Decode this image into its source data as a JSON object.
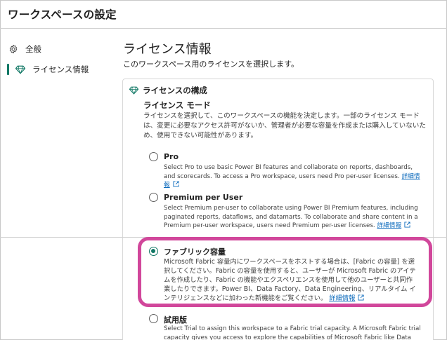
{
  "header": {
    "title": "ワークスペースの設定"
  },
  "sidebar": {
    "items": [
      {
        "label": "全般",
        "icon": "gear-icon"
      },
      {
        "label": "ライセンス情報",
        "icon": "diamond-icon"
      }
    ]
  },
  "main": {
    "title": "ライセンス情報",
    "subtitle": "このワークスペース用のライセンスを選択します。",
    "card": {
      "heading": "ライセンスの構成",
      "mode_heading": "ライセンス モード",
      "mode_description": "ライセンスを選択して、このワークスペースの機能を決定します。一部のライセンス モードは、変更に必要なアクセス許可がないか、管理者が必要な容量を作成または購入していないため、使用できない可能性があります。",
      "options": [
        {
          "title": "Pro",
          "description": "Select Pro to use basic Power BI features and collaborate on reports, dashboards, and scorecards. To access a Pro workspace, users need Pro per-user licenses.",
          "link": "詳細情報",
          "checked": false
        },
        {
          "title": "Premium per User",
          "description": "Select Premium per-user to collaborate using Power BI Premium features, including paginated reports, dataflows, and datamarts. To collaborate and share content in a Premium per-user workspace, users need Premium per-user licenses.",
          "link": "詳細情報",
          "checked": false
        },
        {
          "title": "ファブリック容量",
          "description": "Microsoft Fabric 容量内にワークスペースをホストする場合は、[Fabric の容量] を選択してください。Fabric の容量を使用すると、ユーザーが Microsoft Fabric のアイテムを作成したり、Fabric の機能やエクスペリエンスを使用して他のユーザーと共同作業したりできます。Power BI、Data Factory、Data Engineering、リアルタイム インテリジェンスなどに加わった新機能をご覧ください。",
          "link": "詳細情報",
          "checked": true
        },
        {
          "title": "試用版",
          "description": "Select Trial to assign this workspace to a Fabric trial capacity. A Microsoft Fabric trial capacity gives you access to explore the capabilities of Microsoft Fabric like Data Factory, Data Engineering,",
          "link": "",
          "checked": false
        }
      ]
    }
  },
  "colors": {
    "accent": "#117865",
    "highlight": "#d1479b",
    "link": "#0f6cbd"
  }
}
